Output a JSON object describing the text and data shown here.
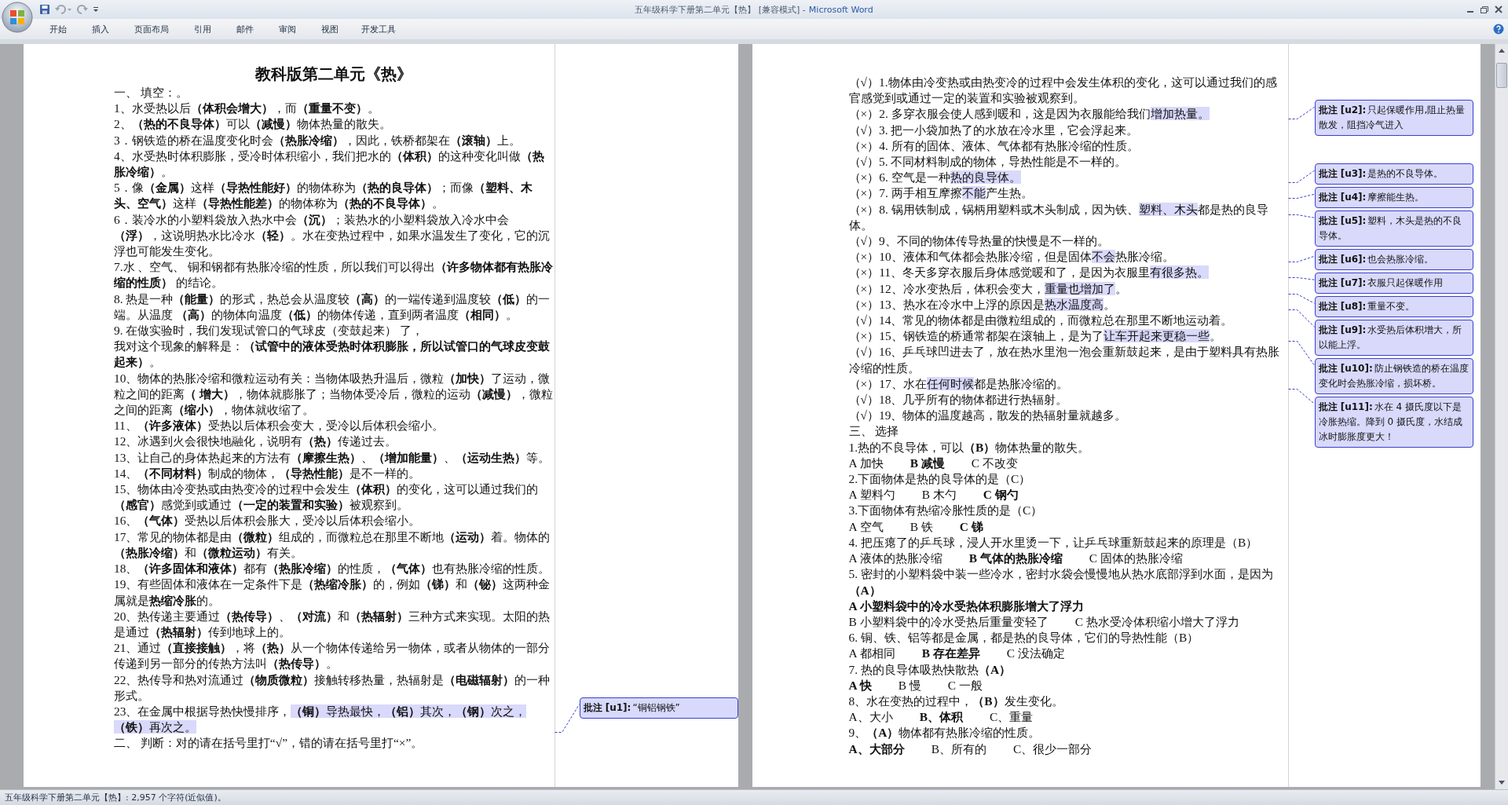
{
  "window": {
    "title": "五年级科学下册第二单元【热】 [兼容模式] -",
    "app": "Microsoft Word"
  },
  "ribbon_tabs": [
    "开始",
    "插入",
    "页面布局",
    "引用",
    "邮件",
    "审阅",
    "视图",
    "开发工具"
  ],
  "left_page": {
    "title": "教科版第二单元《热》",
    "paragraphs": [
      {
        "text": "一、 填空：。"
      },
      {
        "text": "1、水受热以后**（体积会增大）**，而**（重量不变）**。"
      },
      {
        "text": "2、**（热的不良导体）**可以**（减慢）**物体热量的散失。"
      },
      {
        "text": "3．钢铁造的桥在温度变化时会**（热胀冷缩）**，因此，铁桥都架在**（滚轴）**上。"
      },
      {
        "text": "4、水受热时体积膨胀，受冷时体积缩小，我们把水的**（体积）**的这种变化叫做**（热胀冷缩）**。"
      },
      {
        "text": "5．像**（金属）**这样**（导热性能好）**的物体称为**（热的良导体）**；而像**（塑料、木头、空气）**这样**（导热性能差）**的物体称为**（热的不良导体）**。"
      },
      {
        "text": "6．装冷水的小塑料袋放入热水中会**（沉）**；装热水的小塑料袋放入冷水中会**（浮）**，这说明热水比冷水**（轻）**。水在变热过程中，如果水温发生了变化，它的沉浮也可能发生变化。"
      },
      {
        "text": "7.水 、空气、 铜和钢都有热胀冷缩的性质，所以我们可以得出**（许多物体都有热胀冷缩的性质）** 的结论。"
      },
      {
        "text": "8. 热是一种**（能量）**的形式，热总会从温度较**（高）**的一端传递到温度较**（低）**的一端。从温度 **（高）**的物体向温度**（低）**的物体传递，直到两者温度**（相同）**。"
      },
      {
        "text": "9. 在做实验时，我们发现试管口的气球皮（变鼓起来） 了，"
      },
      {
        "text": "我对这个现象的解释是：**（试管中的液体受热时体积膨胀，所以试管口的气球皮变鼓起来）**。"
      },
      {
        "text": "10、物体的热胀冷缩和微粒运动有关：当物体吸热升温后，微粒**（加快）**了运动，微粒之间的距离**（ 增大）**，物体就膨胀了；当物体受冷后，微粒的运动**（减慢）**，微粒之间的距离**（缩小）**，物体就收缩了。"
      },
      {
        "text": "11、**（许多液体）**受热以后体积会变大，受冷以后体积会缩小。"
      },
      {
        "text": "12、冰遇到火会很快地融化，说明有**（热）**传递过去。"
      },
      {
        "text": "13、让自己的身体热起来的方法有**（摩擦生热）**、**（增加能量）**、**（运动生热）**等。"
      },
      {
        "text": "14、**（不同材料）**制成的物体，**（导热性能）**是不一样的。"
      },
      {
        "text": "15、物体由冷变热或由热变冷的过程中会发生**（体积）**的变化，这可以通过我们的**（感官）**感觉到或通过**（一定的装置和实验）**被观察到。"
      },
      {
        "text": "16、**（气体）**受热以后体积会胀大，受冷以后体积会缩小。"
      },
      {
        "text": "17、常见的物体都是由**（微粒）**组成的，而微粒总在那里不断地**（运动）**着。物体的**（热胀冷缩）**和**（微粒运动）**有关。"
      },
      {
        "text": "18、**（许多固体和液体）**都有**（热胀冷缩）**的性质，**（气体）**也有热胀冷缩的性质。"
      },
      {
        "text": "19、有些固体和液体在一定条件下是**（热缩冷胀）**的，例如**（锑）**和**（铋）**这两种金属就是**热缩冷胀**的。"
      },
      {
        "text": "20、热传递主要通过**（热传导）**、**（对流）**和**（热辐射）**三种方式来实现。太阳的热是通过**（热辐射）**传到地球上的。"
      },
      {
        "text": "21、通过**（直接接触）**，将**（热）**从一个物体传递给另一物体，或者从物体的一部分传递到另一部分的传热方法叫**（热传导）**。"
      },
      {
        "text": "22、热传导和热对流通过**（物质微粒）**接触转移热量，热辐射是**（电磁辐射）**的一种形式。"
      },
      {
        "text": "23、在金属中根据导热快慢排序，",
        "highlight": "**（铜）**导热最快，**（铝）**其次，**（钢）**次之，**（铁）**再次之。",
        "comment": {
          "label": "批注 [u1]:",
          "text": "“铜铝钢铁”"
        }
      },
      {
        "text": "二、 判断：对的请在括号里打“√”，错的请在括号里打“×”。"
      }
    ]
  },
  "right_page": {
    "judgments": [
      {
        "mark": "（√）",
        "text": "1.物体由冷变热或由热变冷的过程中会发生体积的变化，这可以通过我们的感官感觉到或通过一定的装置和实验被观察到。"
      },
      {
        "mark": "（×）",
        "text": "2. 多穿衣服会使人感到暖和，这是因为衣服能给我们",
        "highlight": "增加热量。",
        "comment": {
          "label": "批注 [u2]:",
          "text": "只起保暖作用,阻止热量散发，阻挡冷气进入"
        }
      },
      {
        "mark": "（√）",
        "text": "3. 把一小袋加热了的水放在冷水里，它会浮起来。"
      },
      {
        "mark": "（×）",
        "text": "4. 所有的固体、液体、气体都有热胀冷缩的性质。"
      },
      {
        "mark": "（√）",
        "text": "5. 不同材料制成的物体，导热性能是不一样的。"
      },
      {
        "mark": "（×）",
        "text": "6. 空气是一种",
        "highlight": "热的良导体。",
        "comment": {
          "label": "批注 [u3]:",
          "text": "是热的不良导体。"
        }
      },
      {
        "mark": "（×）",
        "text": "7. 两手相互摩擦",
        "highlight": "不能",
        "after": "产生热。",
        "comment": {
          "label": "批注 [u4]:",
          "text": "摩擦能生热。"
        }
      },
      {
        "mark": "（×）",
        "text": "8. 锅用铁制成，锅柄用塑料或木头制成，因为铁、",
        "highlight": "塑料、木头",
        "after": "都是热的良导体。",
        "comment": {
          "label": "批注 [u5]:",
          "text": "塑料，木头是热的不良导体。"
        }
      },
      {
        "mark": "（√）",
        "text": "9、不同的物体传导热量的快慢是不一样的。"
      },
      {
        "mark": "（×）",
        "text": "10、液体和气体都会热胀冷缩，但是固体",
        "highlight": "不会",
        "after": "热胀冷缩。",
        "comment": {
          "label": "批注 [u6]:",
          "text": "也会热胀冷缩。"
        }
      },
      {
        "mark": "（×）",
        "text": "11、冬天多穿衣服后身体感觉暖和了，是因为衣服里",
        "highlight": "有很多热。",
        "comment": {
          "label": "批注 [u7]:",
          "text": "衣服只起保暖作用"
        }
      },
      {
        "mark": "（×）",
        "text": "12、冷水变热后，体积会变大，",
        "highlight": "重量也增加了",
        "after": "。",
        "comment": {
          "label": "批注 [u8]:",
          "text": "重量不变。"
        }
      },
      {
        "mark": "（×）",
        "text": "13、热水在冷水中上浮的原因是",
        "highlight": "热水温度高",
        "after": "。",
        "comment": {
          "label": "批注 [u9]:",
          "text": "水受热后体积增大，所以能上浮。"
        }
      },
      {
        "mark": "（√）",
        "text": "14、常见的物体都是由微粒组成的，而微粒总在那里不断地运动着。"
      },
      {
        "mark": "（×）",
        "text": "15、钢铁造的桥通常都架在滚轴上，是为了",
        "highlight": "让车开起来更稳一些",
        "after": "。",
        "comment": {
          "label": "批注 [u10]:",
          "text": "防止钢铁造的桥在温度变化时会热胀冷缩，损坏桥。"
        }
      },
      {
        "mark": "（√）",
        "text": "16、乒乓球凹进去了，放在热水里泡一泡会重新鼓起来，是由于塑料具有热胀冷缩的性质。"
      },
      {
        "mark": "（×）",
        "text": "17、水在",
        "highlight": "任何时候",
        "after": "都是热胀冷缩的。",
        "comment": {
          "label": "批注 [u11]:",
          "text": "水在 4 摄氏度以下是冷胀热缩。降到 0 摄氏度，水结成冰时膨胀度更大！"
        }
      },
      {
        "mark": "（√）",
        "text": "18、几乎所有的物体都进行热辐射。"
      },
      {
        "mark": "（√）",
        "text": "19、物体的温度越高，散发的热辐射量就越多。"
      }
    ],
    "section": "三、 选择",
    "questions": [
      {
        "text": "1.热的不良导体，可以**（B）**物体热量的散失。",
        "options": [
          {
            "label": "A 加快",
            "answer": false
          },
          {
            "label": "B 减慢",
            "answer": true
          },
          {
            "label": "C 不改变",
            "answer": false
          }
        ]
      },
      {
        "text": "2.下面物体是热的良导体的是（C）",
        "options": [
          {
            "label": "A 塑料勺",
            "answer": false
          },
          {
            "label": "B 木勺",
            "answer": false
          },
          {
            "label": "C 钢勺",
            "answer": true
          }
        ]
      },
      {
        "text": "3.下面物体有热缩冷胀性质的是（C）",
        "options": [
          {
            "label": "A 空气",
            "answer": false
          },
          {
            "label": "B 铁",
            "answer": false
          },
          {
            "label": "C 锑",
            "answer": true
          }
        ]
      },
      {
        "text": "4. 把压瘪了的乒乓球，浸人开水里烫一下，让乒乓球重新鼓起来的原理是（B）",
        "options": [
          {
            "label": "A 液体的热胀冷缩",
            "answer": false
          },
          {
            "label": "B 气体的热胀冷缩",
            "answer": true
          },
          {
            "label": "C 固体的热胀冷缩",
            "answer": false
          }
        ]
      },
      {
        "text": "5. 密封的小塑料袋中装一些冷水，密封水袋会慢慢地从热水底部浮到水面，是因为**（A）**",
        "options": [
          {
            "label": "A 小塑料袋中的冷水受热体积膨胀增大了浮力",
            "answer": true
          },
          {
            "label": "B 小塑料袋中的冷水受热后重量变轻了",
            "answer": false
          },
          {
            "label": "C 热水受冷体积缩小增大了浮力",
            "answer": false
          }
        ]
      },
      {
        "text": "6. 铜、铁、铝等都是金属，都是热的良导体，它们的导热性能（B）",
        "options": [
          {
            "label": "A 都相同",
            "answer": false
          },
          {
            "label": "B 存在差异",
            "answer": true
          },
          {
            "label": "C 没法确定",
            "answer": false
          }
        ]
      },
      {
        "text": "7. 热的良导体吸热快散热**（A）**",
        "options": [
          {
            "label": "A 快",
            "answer": true
          },
          {
            "label": "B 慢",
            "answer": false
          },
          {
            "label": "C 一般",
            "answer": false
          }
        ]
      },
      {
        "text": "8、水在变热的过程中，**（B）**发生变化。",
        "options": [
          {
            "label": "A、大小",
            "answer": false
          },
          {
            "label": "B、体积",
            "answer": true
          },
          {
            "label": "C、重量",
            "answer": false
          }
        ]
      },
      {
        "text": "9、**（A）**物体都有热胀冷缩的性质。",
        "options": [
          {
            "label": "A、大部分",
            "answer": true
          },
          {
            "label": "B、所有的",
            "answer": false
          },
          {
            "label": "C、很少一部分",
            "answer": false
          }
        ]
      }
    ]
  },
  "status_bar": "五年级科学下册第二单元【热】: 2,957 个字符(近似值)。"
}
